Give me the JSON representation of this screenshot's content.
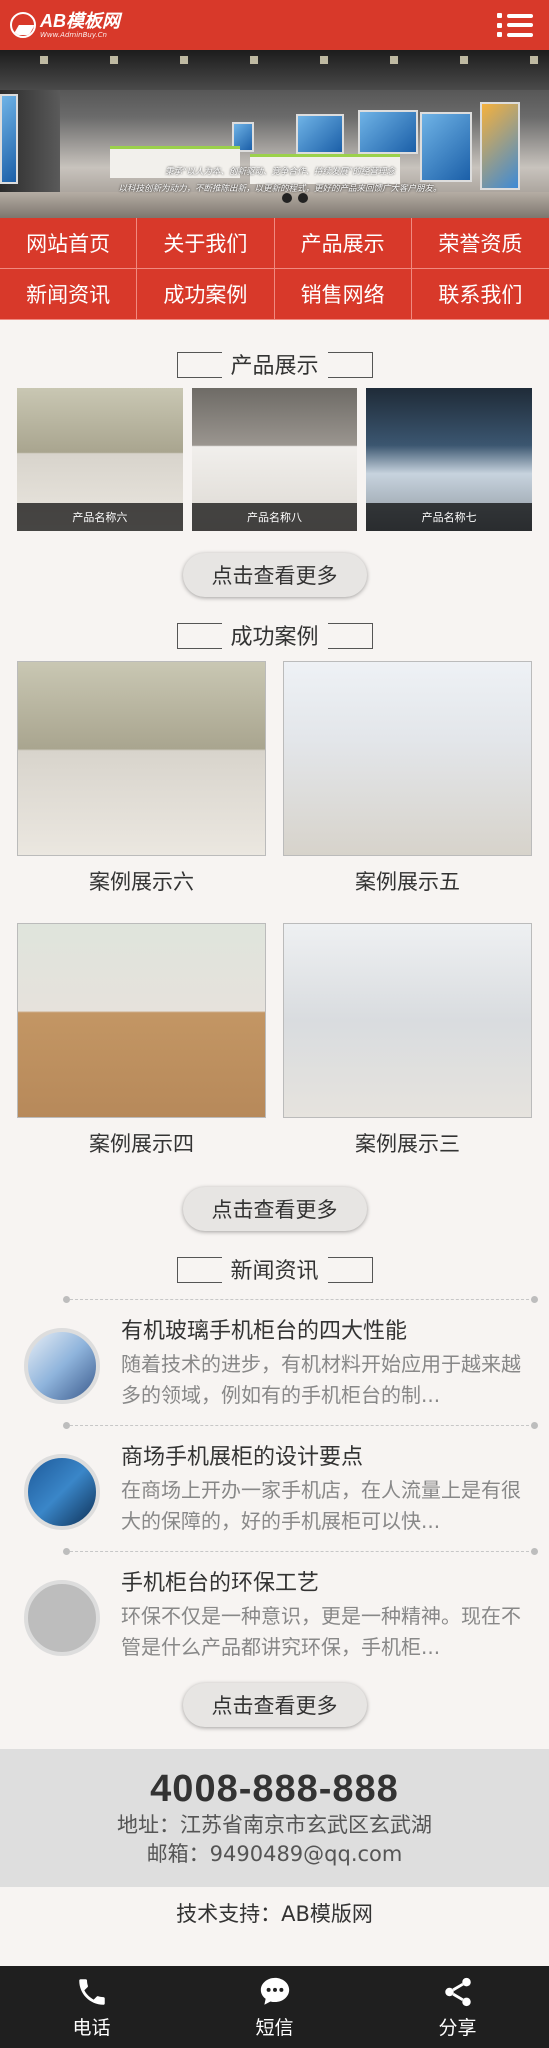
{
  "header": {
    "logo_title": "AB模板网",
    "logo_subtitle": "Www.AdminBuy.Cn",
    "menu_icon": "menu-icon"
  },
  "banner": {
    "caption_line1": "秉承“以人为本、创新驱动、竞争合作、持续发展”的经营理念",
    "caption_line2": "以科技创新为动力，不断推陈出新，以更新的程式，更好的产品来回馈广大客户朋友。",
    "slide_count": 2
  },
  "nav": [
    {
      "label": "网站首页"
    },
    {
      "label": "关于我们"
    },
    {
      "label": "产品展示"
    },
    {
      "label": "荣誉资质"
    },
    {
      "label": "新闻资讯"
    },
    {
      "label": "成功案例"
    },
    {
      "label": "销售网络"
    },
    {
      "label": "联系我们"
    }
  ],
  "products": {
    "title": "产品展示",
    "items": [
      {
        "name": "产品名称六"
      },
      {
        "name": "产品名称八"
      },
      {
        "name": "产品名称七"
      }
    ],
    "more": "点击查看更多"
  },
  "cases": {
    "title": "成功案例",
    "items": [
      {
        "name": "案例展示六"
      },
      {
        "name": "案例展示五"
      },
      {
        "name": "案例展示四"
      },
      {
        "name": "案例展示三"
      }
    ],
    "more": "点击查看更多"
  },
  "news": {
    "title": "新闻资讯",
    "items": [
      {
        "title": "有机玻璃手机柜台的四大性能",
        "desc": "随着技术的进步，有机材料开始应用于越来越多的领域，例如有的手机柜台的制..."
      },
      {
        "title": "商场手机展柜的设计要点",
        "desc": "在商场上开办一家手机店，在人流量上是有很大的保障的，好的手机展柜可以快..."
      },
      {
        "title": "手机柜台的环保工艺",
        "desc": "环保不仅是一种意识，更是一种精神。现在不管是什么产品都讲究环保，手机柜..."
      }
    ],
    "more": "点击查看更多"
  },
  "contact": {
    "phone": "4008-888-888",
    "address": "地址：江苏省南京市玄武区玄武湖",
    "email": "邮箱：9490489@qq.com",
    "support": "技术支持：AB模版网"
  },
  "bottombar": [
    {
      "label": "电话",
      "icon": "phone-icon"
    },
    {
      "label": "短信",
      "icon": "sms-icon"
    },
    {
      "label": "分享",
      "icon": "share-icon"
    }
  ],
  "colors": {
    "brand": "#d8392a",
    "footer_bar": "#1f1f1f"
  }
}
